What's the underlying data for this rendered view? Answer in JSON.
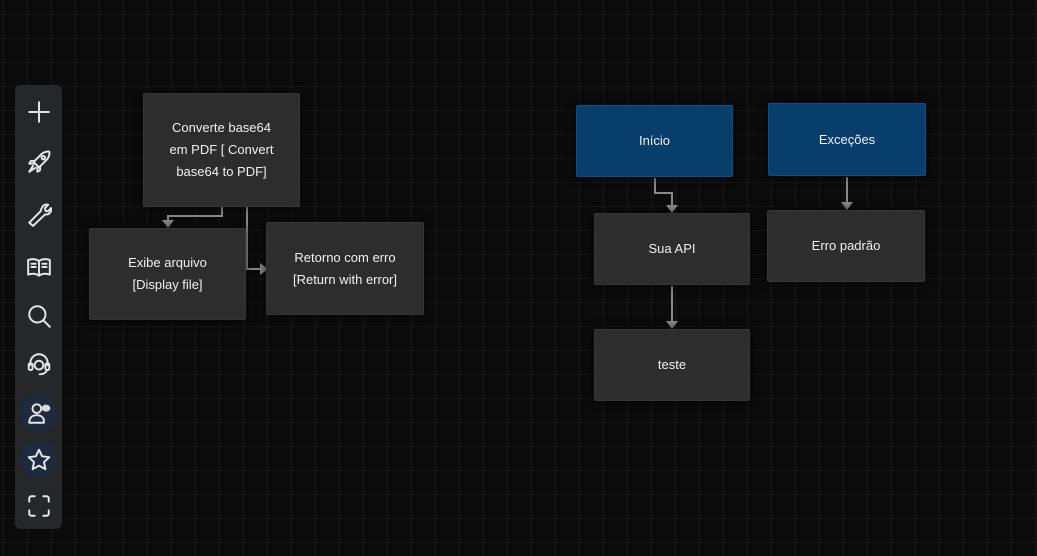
{
  "toolbar": {
    "items": [
      {
        "name": "add",
        "icon": "plus-icon"
      },
      {
        "name": "deploy",
        "icon": "rocket-icon"
      },
      {
        "name": "settings",
        "icon": "wrench-icon"
      },
      {
        "name": "docs",
        "icon": "open-book-icon"
      },
      {
        "name": "search",
        "icon": "search-icon"
      },
      {
        "name": "support",
        "icon": "headset-icon"
      },
      {
        "name": "users",
        "icon": "user-chat-icon"
      },
      {
        "name": "favorites",
        "icon": "star-icon"
      },
      {
        "name": "fit-view",
        "icon": "fullscreen-frame-icon"
      }
    ]
  },
  "flow": {
    "nodes": {
      "converte": {
        "label": "Converte base64\nem PDF [ Convert\nbase64 to PDF]"
      },
      "exibe": {
        "label": "Exibe arquivo\n[Display file]"
      },
      "retorno": {
        "label": "Retorno com erro\n[Return with error]"
      },
      "inicio": {
        "label": "Início"
      },
      "sua_api": {
        "label": "Sua API"
      },
      "teste": {
        "label": "teste"
      },
      "excecoes": {
        "label": "Exceções"
      },
      "erro_padrao": {
        "label": "Erro padrão"
      }
    }
  },
  "colors": {
    "canvas": "#0b0b0b",
    "node": "#2d2d2d",
    "start_node": "#083e6c",
    "edge": "#8a8a8a",
    "toolbar": "#262729"
  }
}
